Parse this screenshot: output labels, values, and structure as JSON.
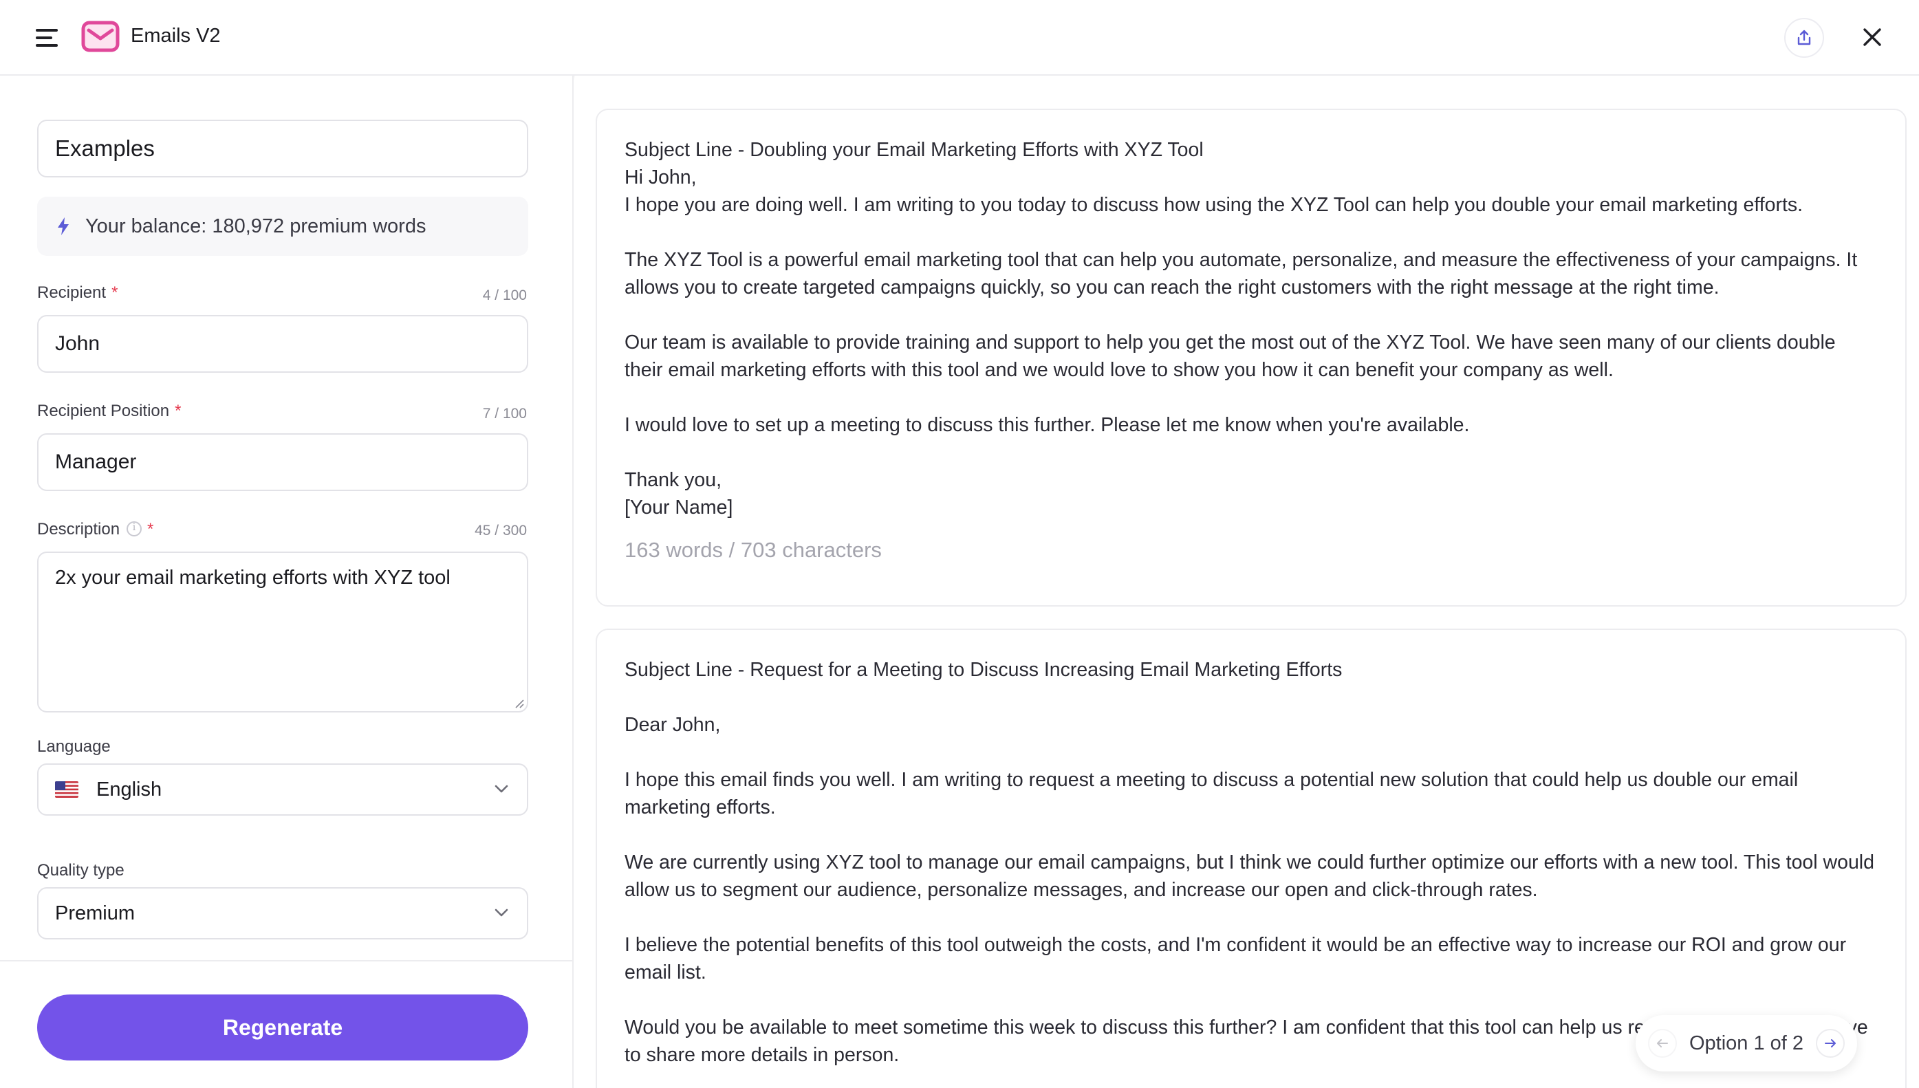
{
  "header": {
    "title": "Emails V2",
    "menu_icon": "hamburger-icon",
    "app_icon": "envelope-icon",
    "share_icon": "share-icon",
    "close_icon": "close-icon",
    "accent_color": "#e0489a"
  },
  "form": {
    "examples_label": "Examples",
    "balance_text": "Your balance: 180,972 premium words",
    "recipient": {
      "label": "Recipient",
      "required": "*",
      "counter": "4 / 100",
      "value": "John"
    },
    "recipient_position": {
      "label": "Recipient Position",
      "required": "*",
      "counter": "7 / 100",
      "value": "Manager"
    },
    "description": {
      "label": "Description",
      "required": "*",
      "counter": "45 / 300",
      "value": "2x your email marketing efforts with XYZ tool"
    },
    "language": {
      "label": "Language",
      "value": "English",
      "flag_icon": "us-flag-icon"
    },
    "quality_type": {
      "label": "Quality type",
      "value": "Premium"
    },
    "regenerate_label": "Regenerate",
    "button_color": "#7353e9"
  },
  "results": {
    "option1": {
      "subject": "Subject Line - Doubling your Email Marketing Efforts with XYZ Tool",
      "greeting": "Hi John,",
      "p1": "I hope you are doing well. I am writing to you today to discuss how using the XYZ Tool can help you double your email marketing efforts.",
      "p2": "The XYZ Tool is a powerful email marketing tool that can help you automate, personalize, and measure the effectiveness of your campaigns. It allows you to create targeted campaigns quickly, so you can reach the right customers with the right message at the right time.",
      "p3": "Our team is available to provide training and support to help you get the most out of the XYZ Tool. We have seen many of our clients double their email marketing efforts with this tool and we would love to show you how it can benefit your company as well.",
      "p4": "I would love to set up a meeting to discuss this further. Please let me know when you're available.",
      "closing": "Thank you,",
      "signature": "[Your Name]",
      "stats": "163 words / 703 characters"
    },
    "option2": {
      "subject": "Subject Line - Request for a Meeting to Discuss Increasing Email Marketing Efforts",
      "greeting": "Dear John,",
      "p1": "I hope this email finds you well. I am writing to request a meeting to discuss a potential new solution that could help us double our email marketing efforts.",
      "p2": "We are currently using XYZ tool to manage our email campaigns, but I think we could further optimize our efforts with a new tool. This tool would allow us to segment our audience, personalize messages, and increase our open and click-through rates.",
      "p3": "I believe the potential benefits of this tool outweigh the costs, and I'm confident it would be an effective way to increase our ROI and grow our email list.",
      "p4": "Would you be available to meet sometime this week to discuss this further? I am confident that this tool can help us reach our goals and I'd love to share more details in person."
    },
    "pager": {
      "text": "Option 1 of 2",
      "prev_icon": "arrow-left-icon",
      "next_icon": "arrow-right-icon"
    }
  }
}
